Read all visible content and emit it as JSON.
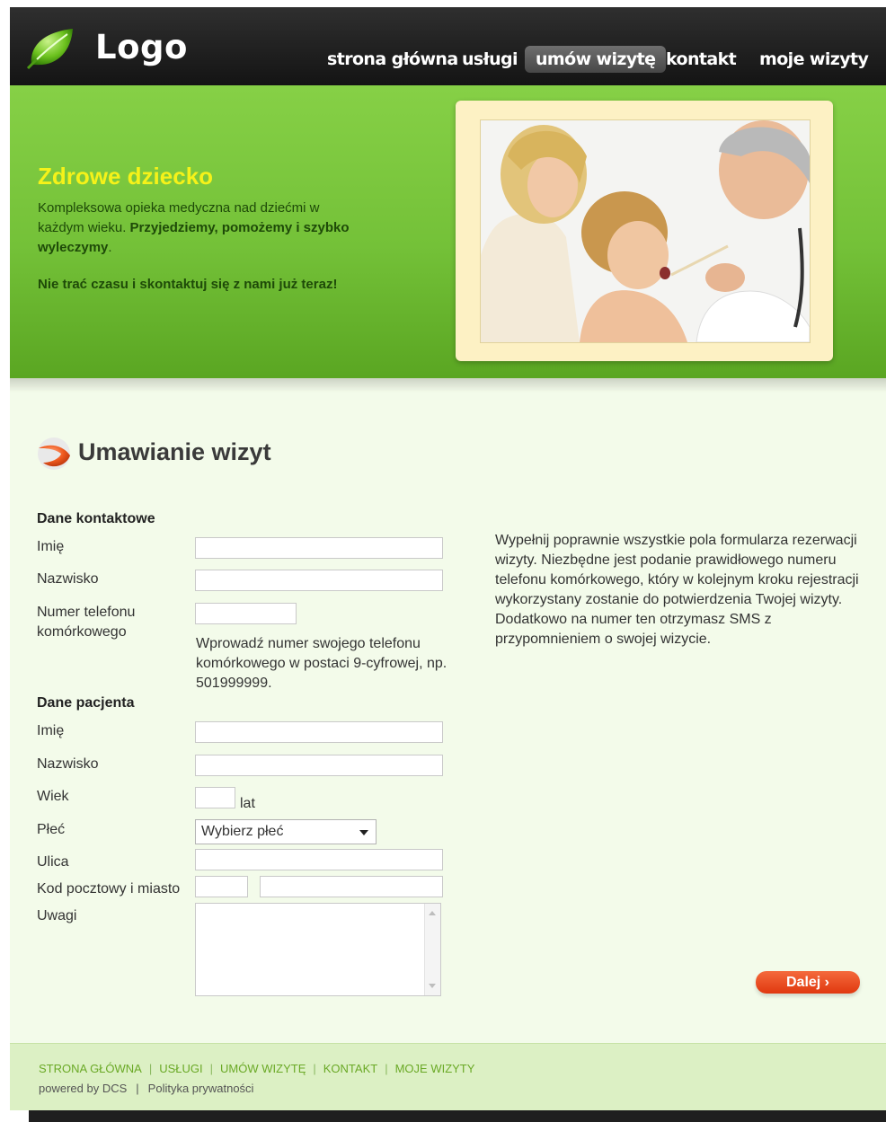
{
  "header": {
    "logo_text": "Logo",
    "nav": [
      {
        "label": "strona główna",
        "active": false
      },
      {
        "label": "usługi",
        "active": false
      },
      {
        "label": "umów wizytę",
        "active": true
      },
      {
        "label": "kontakt",
        "active": false
      },
      {
        "label": "moje wizyty",
        "active": false
      }
    ]
  },
  "hero": {
    "title": "Zdrowe dziecko",
    "text_part1": "Kompleksowa opieka medyczna nad dziećmi w każdym wieku. ",
    "text_bold": "Przyjedziemy, pomożemy i szybko wyleczymy",
    "text_end": ".",
    "cta": "Nie trać czasu i skontaktuj się z nami już teraz!"
  },
  "form": {
    "title": "Umawianie wizyt",
    "contact_heading": "Dane kontaktowe",
    "contact": {
      "first_name_label": "Imię",
      "last_name_label": "Nazwisko",
      "phone_label": "Numer telefonu komórkowego",
      "phone_hint": "Wprowadź numer swojego telefonu komórkowego w postaci 9-cyfrowej, np. 501999999."
    },
    "patient_heading": "Dane pacjenta",
    "patient": {
      "first_name_label": "Imię",
      "last_name_label": "Nazwisko",
      "age_label": "Wiek",
      "age_unit": "lat",
      "gender_label": "Płeć",
      "gender_selected": "Wybierz płeć",
      "street_label": "Ulica",
      "postal_city_label": "Kod pocztowy i miasto",
      "notes_label": "Uwagi"
    },
    "info_text": "Wypełnij poprawnie wszystkie pola formularza rezerwacji wizyty. Niezbędne jest podanie prawidłowego numeru telefonu komórkowego, który w kolejnym kroku rejestracji wykorzystany zostanie do potwierdzenia Twojej wizyty. Dodatkowo na numer ten otrzymasz SMS z przypomnieniem o swojej wizycie.",
    "next_button": "Dalej  ›"
  },
  "footer": {
    "links": [
      "STRONA GŁÓWNA",
      "USŁUGI",
      "UMÓW WIZYTĘ",
      "KONTAKT",
      "MOJE WIZYTY"
    ],
    "separator": "|",
    "powered_by": "powered by DCS",
    "privacy": "Polityka prywatności"
  },
  "colors": {
    "header_bg": "#1a1a1a",
    "hero_green": "#74c138",
    "hero_title": "#f5f219",
    "page_bg": "#f3fbea",
    "next_button": "#e8481a",
    "footer_link": "#6aa926"
  },
  "icons": {
    "logo": "green-leaf-icon",
    "section": "orange-swoosh-icon",
    "select_arrow": "chevron-down-icon"
  }
}
